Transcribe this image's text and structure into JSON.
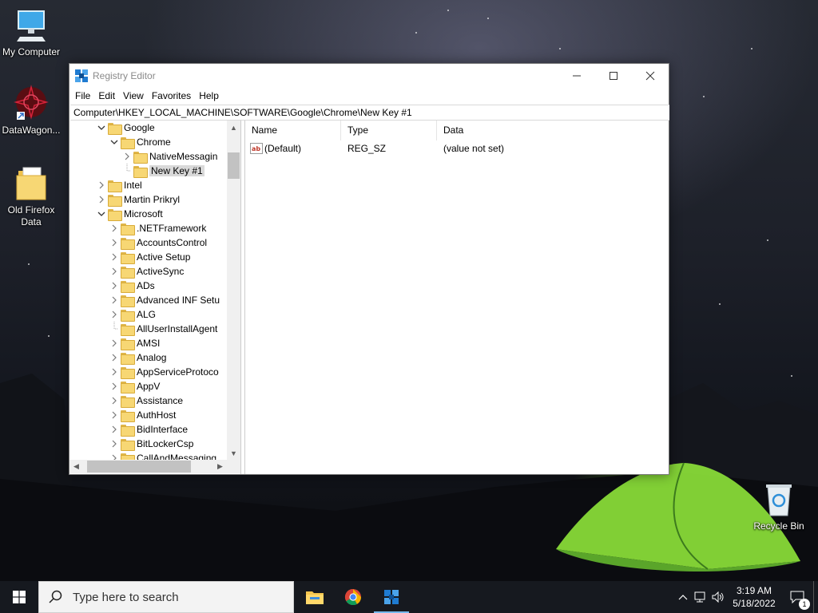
{
  "desktop": {
    "icons": [
      {
        "label": "My Computer"
      },
      {
        "label": "DataWagon..."
      },
      {
        "label": "Old Firefox Data"
      },
      {
        "label": "Recycle Bin"
      }
    ]
  },
  "window": {
    "title": "Registry Editor",
    "menu": [
      "File",
      "Edit",
      "View",
      "Favorites",
      "Help"
    ],
    "address": "Computer\\HKEY_LOCAL_MACHINE\\SOFTWARE\\Google\\Chrome\\New Key #1",
    "tree": [
      {
        "label": "Google",
        "level": 0,
        "state": "expanded"
      },
      {
        "label": "Chrome",
        "level": 1,
        "state": "expanded"
      },
      {
        "label": "NativeMessagin",
        "level": 2,
        "state": "collapsed"
      },
      {
        "label": "New Key #1",
        "level": 2,
        "state": "leaf",
        "selected": true
      },
      {
        "label": "Intel",
        "level": 0,
        "state": "collapsed"
      },
      {
        "label": "Martin Prikryl",
        "level": 0,
        "state": "collapsed"
      },
      {
        "label": "Microsoft",
        "level": 0,
        "state": "expanded"
      },
      {
        "label": ".NETFramework",
        "level": 1,
        "state": "collapsed"
      },
      {
        "label": "AccountsControl",
        "level": 1,
        "state": "collapsed"
      },
      {
        "label": "Active Setup",
        "level": 1,
        "state": "collapsed"
      },
      {
        "label": "ActiveSync",
        "level": 1,
        "state": "collapsed"
      },
      {
        "label": "ADs",
        "level": 1,
        "state": "collapsed"
      },
      {
        "label": "Advanced INF Setu",
        "level": 1,
        "state": "collapsed"
      },
      {
        "label": "ALG",
        "level": 1,
        "state": "collapsed"
      },
      {
        "label": "AllUserInstallAgent",
        "level": 1,
        "state": "leaf"
      },
      {
        "label": "AMSI",
        "level": 1,
        "state": "collapsed"
      },
      {
        "label": "Analog",
        "level": 1,
        "state": "collapsed"
      },
      {
        "label": "AppServiceProtoco",
        "level": 1,
        "state": "collapsed"
      },
      {
        "label": "AppV",
        "level": 1,
        "state": "collapsed"
      },
      {
        "label": "Assistance",
        "level": 1,
        "state": "collapsed"
      },
      {
        "label": "AuthHost",
        "level": 1,
        "state": "collapsed"
      },
      {
        "label": "BidInterface",
        "level": 1,
        "state": "collapsed"
      },
      {
        "label": "BitLockerCsp",
        "level": 1,
        "state": "collapsed"
      },
      {
        "label": "CallAndMessaging",
        "level": 1,
        "state": "collapsed"
      }
    ],
    "columns": [
      "Name",
      "Type",
      "Data"
    ],
    "values": [
      {
        "name": "(Default)",
        "type": "REG_SZ",
        "data": "(value not set)"
      }
    ]
  },
  "taskbar": {
    "search_placeholder": "Type here to search",
    "time": "3:19 AM",
    "date": "5/18/2022",
    "notification_count": "1"
  },
  "colors": {
    "taskbar": "#16191f",
    "active_indicator": "#76b9ed",
    "folder": "#f7d774"
  }
}
